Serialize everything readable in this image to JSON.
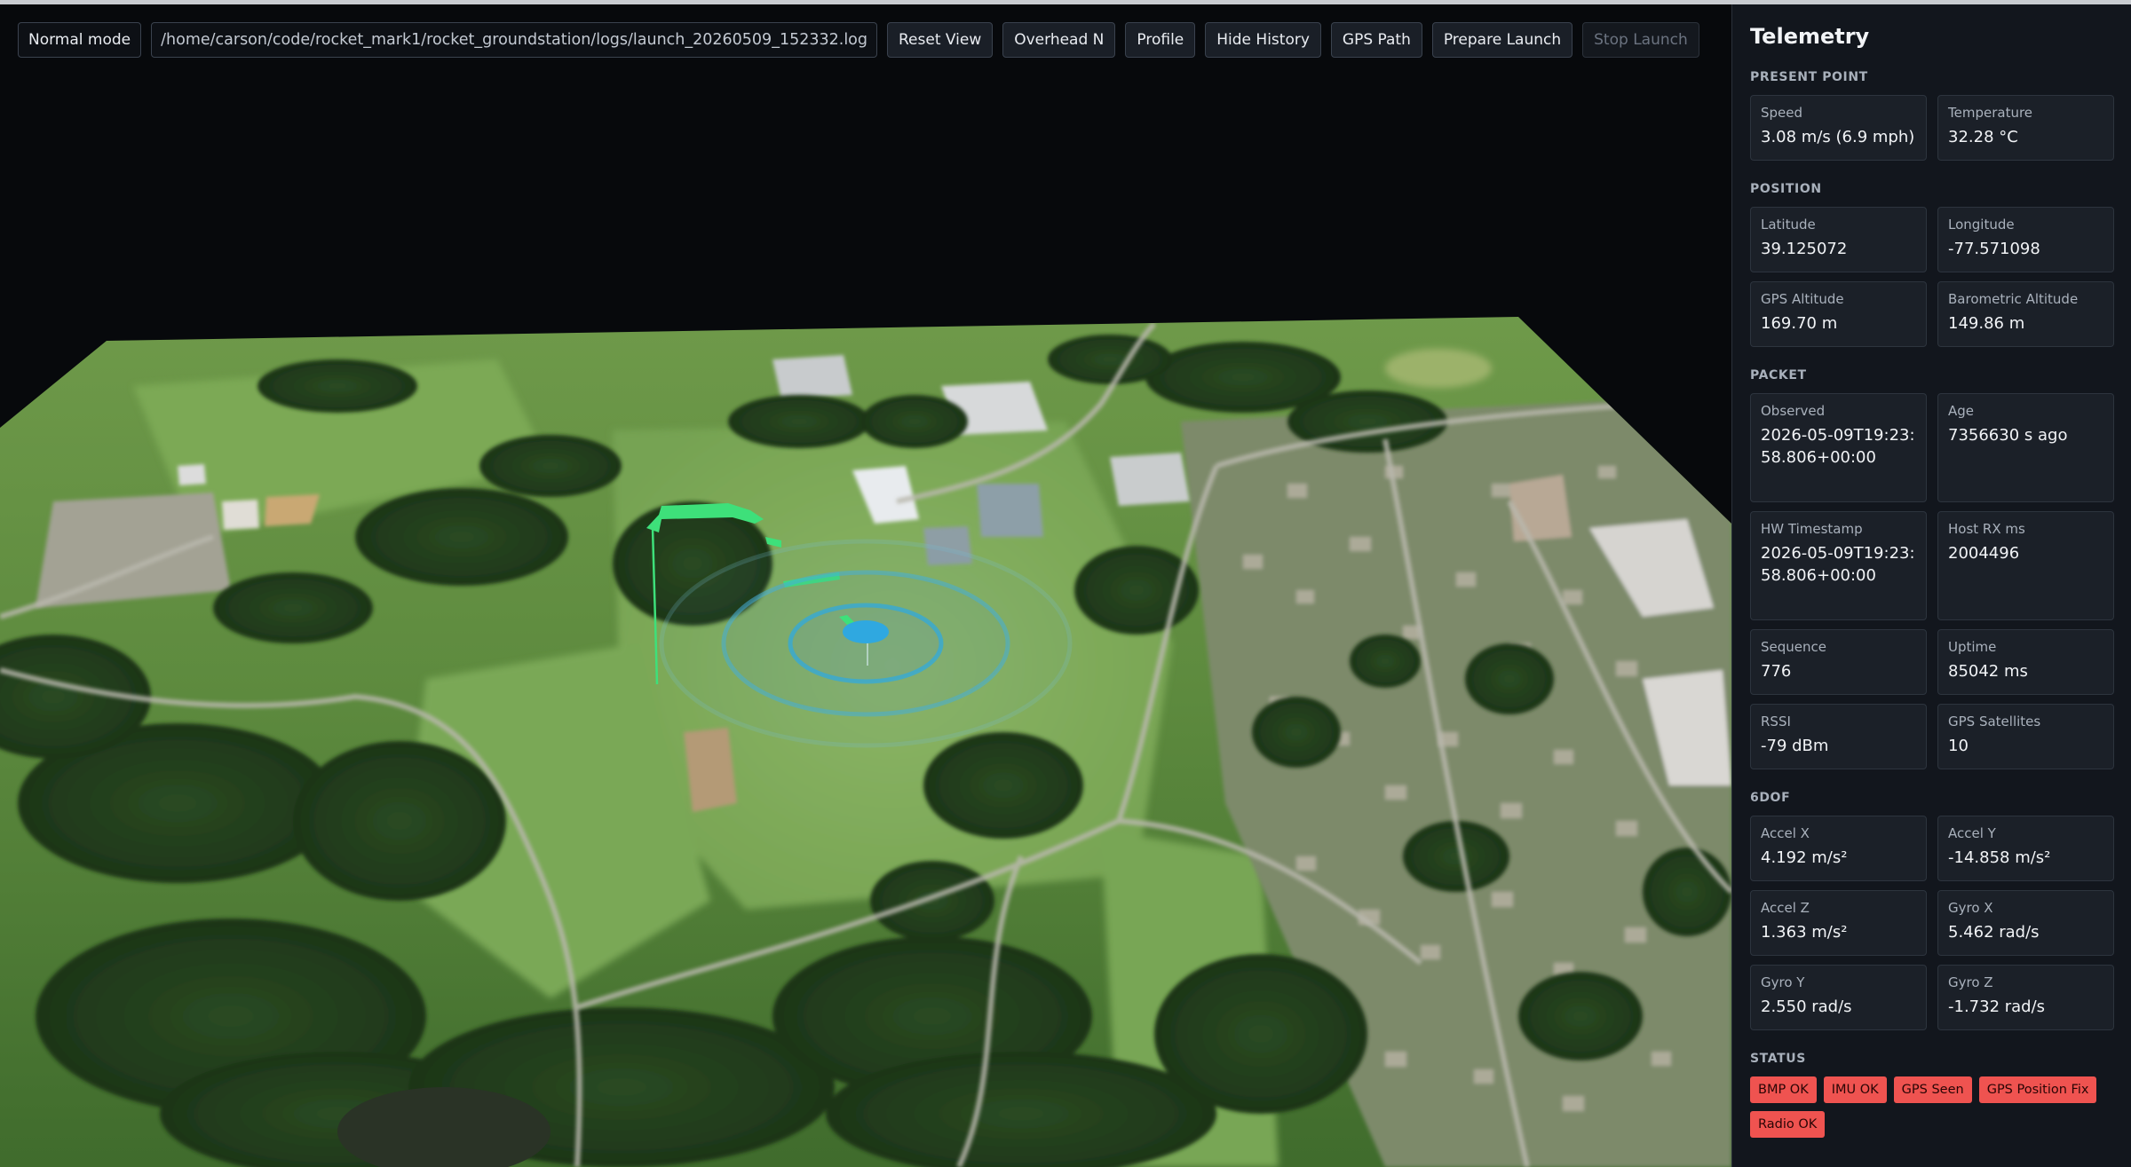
{
  "toolbar": {
    "mode_label": "Normal mode",
    "log_path": "/home/carson/code/rocket_mark1/rocket_groundstation/logs/launch_20260509_152332.log",
    "buttons": {
      "reset_view": "Reset View",
      "overhead": "Overhead N",
      "profile": "Profile",
      "hide_history": "Hide History",
      "gps_path": "GPS Path",
      "prepare_launch": "Prepare Launch",
      "stop_launch": "Stop Launch"
    }
  },
  "telemetry": {
    "title": "Telemetry",
    "present_point": {
      "label": "PRESENT POINT",
      "speed": {
        "label": "Speed",
        "value": "3.08 m/s (6.9 mph)"
      },
      "temperature": {
        "label": "Temperature",
        "value": "32.28 °C"
      }
    },
    "position": {
      "label": "POSITION",
      "latitude": {
        "label": "Latitude",
        "value": "39.125072"
      },
      "longitude": {
        "label": "Longitude",
        "value": "-77.571098"
      },
      "gps_altitude": {
        "label": "GPS Altitude",
        "value": "169.70 m"
      },
      "baro_altitude": {
        "label": "Barometric Altitude",
        "value": "149.86 m"
      }
    },
    "packet": {
      "label": "PACKET",
      "observed": {
        "label": "Observed",
        "value": "2026-05-09T19:23:58.806+00:00"
      },
      "age": {
        "label": "Age",
        "value": "7356630 s ago"
      },
      "hw_timestamp": {
        "label": "HW Timestamp",
        "value": "2026-05-09T19:23:58.806+00:00"
      },
      "host_rx": {
        "label": "Host RX ms",
        "value": "2004496"
      },
      "sequence": {
        "label": "Sequence",
        "value": "776"
      },
      "uptime": {
        "label": "Uptime",
        "value": "85042 ms"
      },
      "rssi": {
        "label": "RSSI",
        "value": "-79 dBm"
      },
      "gps_satellites": {
        "label": "GPS Satellites",
        "value": "10"
      }
    },
    "sixdof": {
      "label": "6DOF",
      "accel_x": {
        "label": "Accel X",
        "value": "4.192 m/s²"
      },
      "accel_y": {
        "label": "Accel Y",
        "value": "-14.858 m/s²"
      },
      "accel_z": {
        "label": "Accel Z",
        "value": "1.363 m/s²"
      },
      "gyro_x": {
        "label": "Gyro X",
        "value": "5.462 rad/s"
      },
      "gyro_y": {
        "label": "Gyro Y",
        "value": "2.550 rad/s"
      },
      "gyro_z": {
        "label": "Gyro Z",
        "value": "-1.732 rad/s"
      }
    },
    "status": {
      "label": "STATUS",
      "bmp": "BMP OK",
      "imu": "IMU OK",
      "gps_seen": "GPS Seen",
      "gps_fix": "GPS Position Fix",
      "radio": "Radio OK"
    }
  },
  "colors": {
    "badge_red": "#ef5350",
    "flight_path": "#3ee07a",
    "marker_blue": "#2fa8e0",
    "sidebar_bg": "#12161d"
  },
  "map": {
    "icon_marker": "rocket-position-marker",
    "icon_rings": "position-accuracy-rings",
    "icon_trail": "flight-history-trail"
  }
}
